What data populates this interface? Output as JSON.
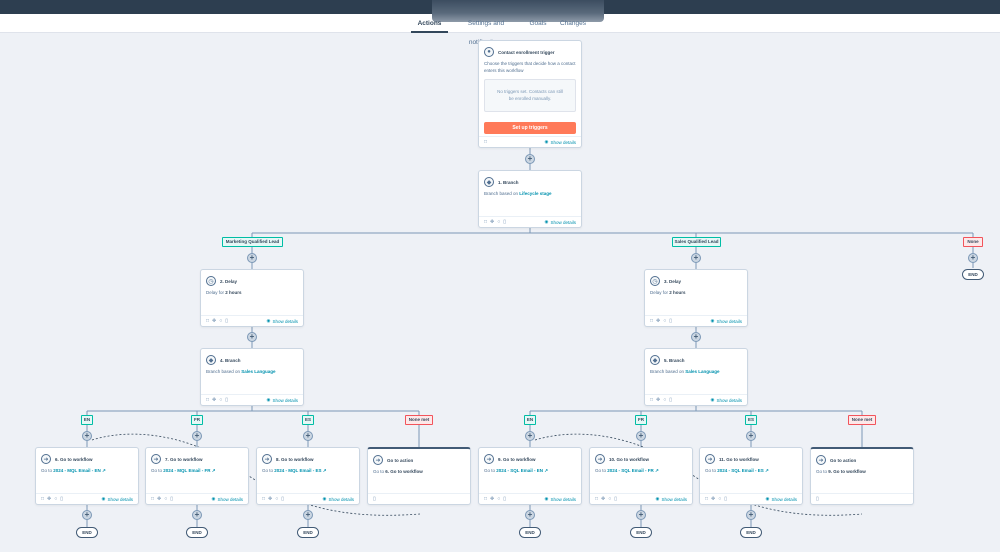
{
  "tabs": [
    {
      "label": "Actions",
      "active": true
    },
    {
      "label": "Settings and notifications",
      "active": false
    },
    {
      "label": "Goals",
      "active": false
    },
    {
      "label": "Changes",
      "active": false
    }
  ],
  "trigger": {
    "title": "Contact enrollment trigger",
    "description": "Choose the triggers that decide how a contact enters this workflow",
    "empty_text": "No triggers set. Contacts can still be enrolled manually.",
    "button_label": "Set up triggers",
    "show_details": "Show details"
  },
  "branch1": {
    "title": "1. Branch",
    "prefix": "Branch based on",
    "property": "Lifecycle stage",
    "show_details": "Show details"
  },
  "branch1_labels": {
    "left": "Marketing Qualified Lead",
    "right": "Sales Qualified Lead",
    "none": "None"
  },
  "delays": [
    {
      "title": "2. Delay",
      "prefix": "Delay for",
      "amount": "2 hours",
      "show_details": "Show details"
    },
    {
      "title": "3. Delay",
      "prefix": "Delay for",
      "amount": "2 hours",
      "show_details": "Show details"
    }
  ],
  "branches": [
    {
      "title": "4. Branch",
      "prefix": "Branch based on",
      "property": "Sales Language",
      "show_details": "Show details"
    },
    {
      "title": "5. Branch",
      "prefix": "Branch based on",
      "property": "Sales Language",
      "show_details": "Show details"
    }
  ],
  "lang_labels": [
    "EN",
    "FR",
    "ES",
    "None met"
  ],
  "goto_workflows": [
    {
      "title": "6. Go to workflow",
      "prefix": "Go to",
      "target": "2024 - MQL Email - EN",
      "show_details": "Show details"
    },
    {
      "title": "7. Go to workflow",
      "prefix": "Go to",
      "target": "2024 - MQL Email - FR",
      "show_details": "Show details"
    },
    {
      "title": "8. Go to workflow",
      "prefix": "Go to",
      "target": "2024 - MQL Email - ES",
      "show_details": "Show details"
    },
    {
      "title": "9. Go to workflow",
      "prefix": "Go to",
      "target": "2024 - SQL Email - EN",
      "show_details": "Show details"
    },
    {
      "title": "10. Go to workflow",
      "prefix": "Go to",
      "target": "2024 - SQL Email - FR",
      "show_details": "Show details"
    },
    {
      "title": "11. Go to workflow",
      "prefix": "Go to",
      "target": "2024 - SQL Email - ES",
      "show_details": "Show details"
    }
  ],
  "goto_actions": [
    {
      "title": "Go to action",
      "prefix": "Go to",
      "target": "6. Go to workflow"
    },
    {
      "title": "Go to action",
      "prefix": "Go to",
      "target": "9. Go to workflow"
    }
  ],
  "end_label": "END",
  "plus_symbol": "+",
  "colors": {
    "accent_orange": "#ff7a59",
    "branch_teal": "#00bda5",
    "none_coral": "#f2545b",
    "link": "#0091ae",
    "topbar": "#2d3e50"
  }
}
